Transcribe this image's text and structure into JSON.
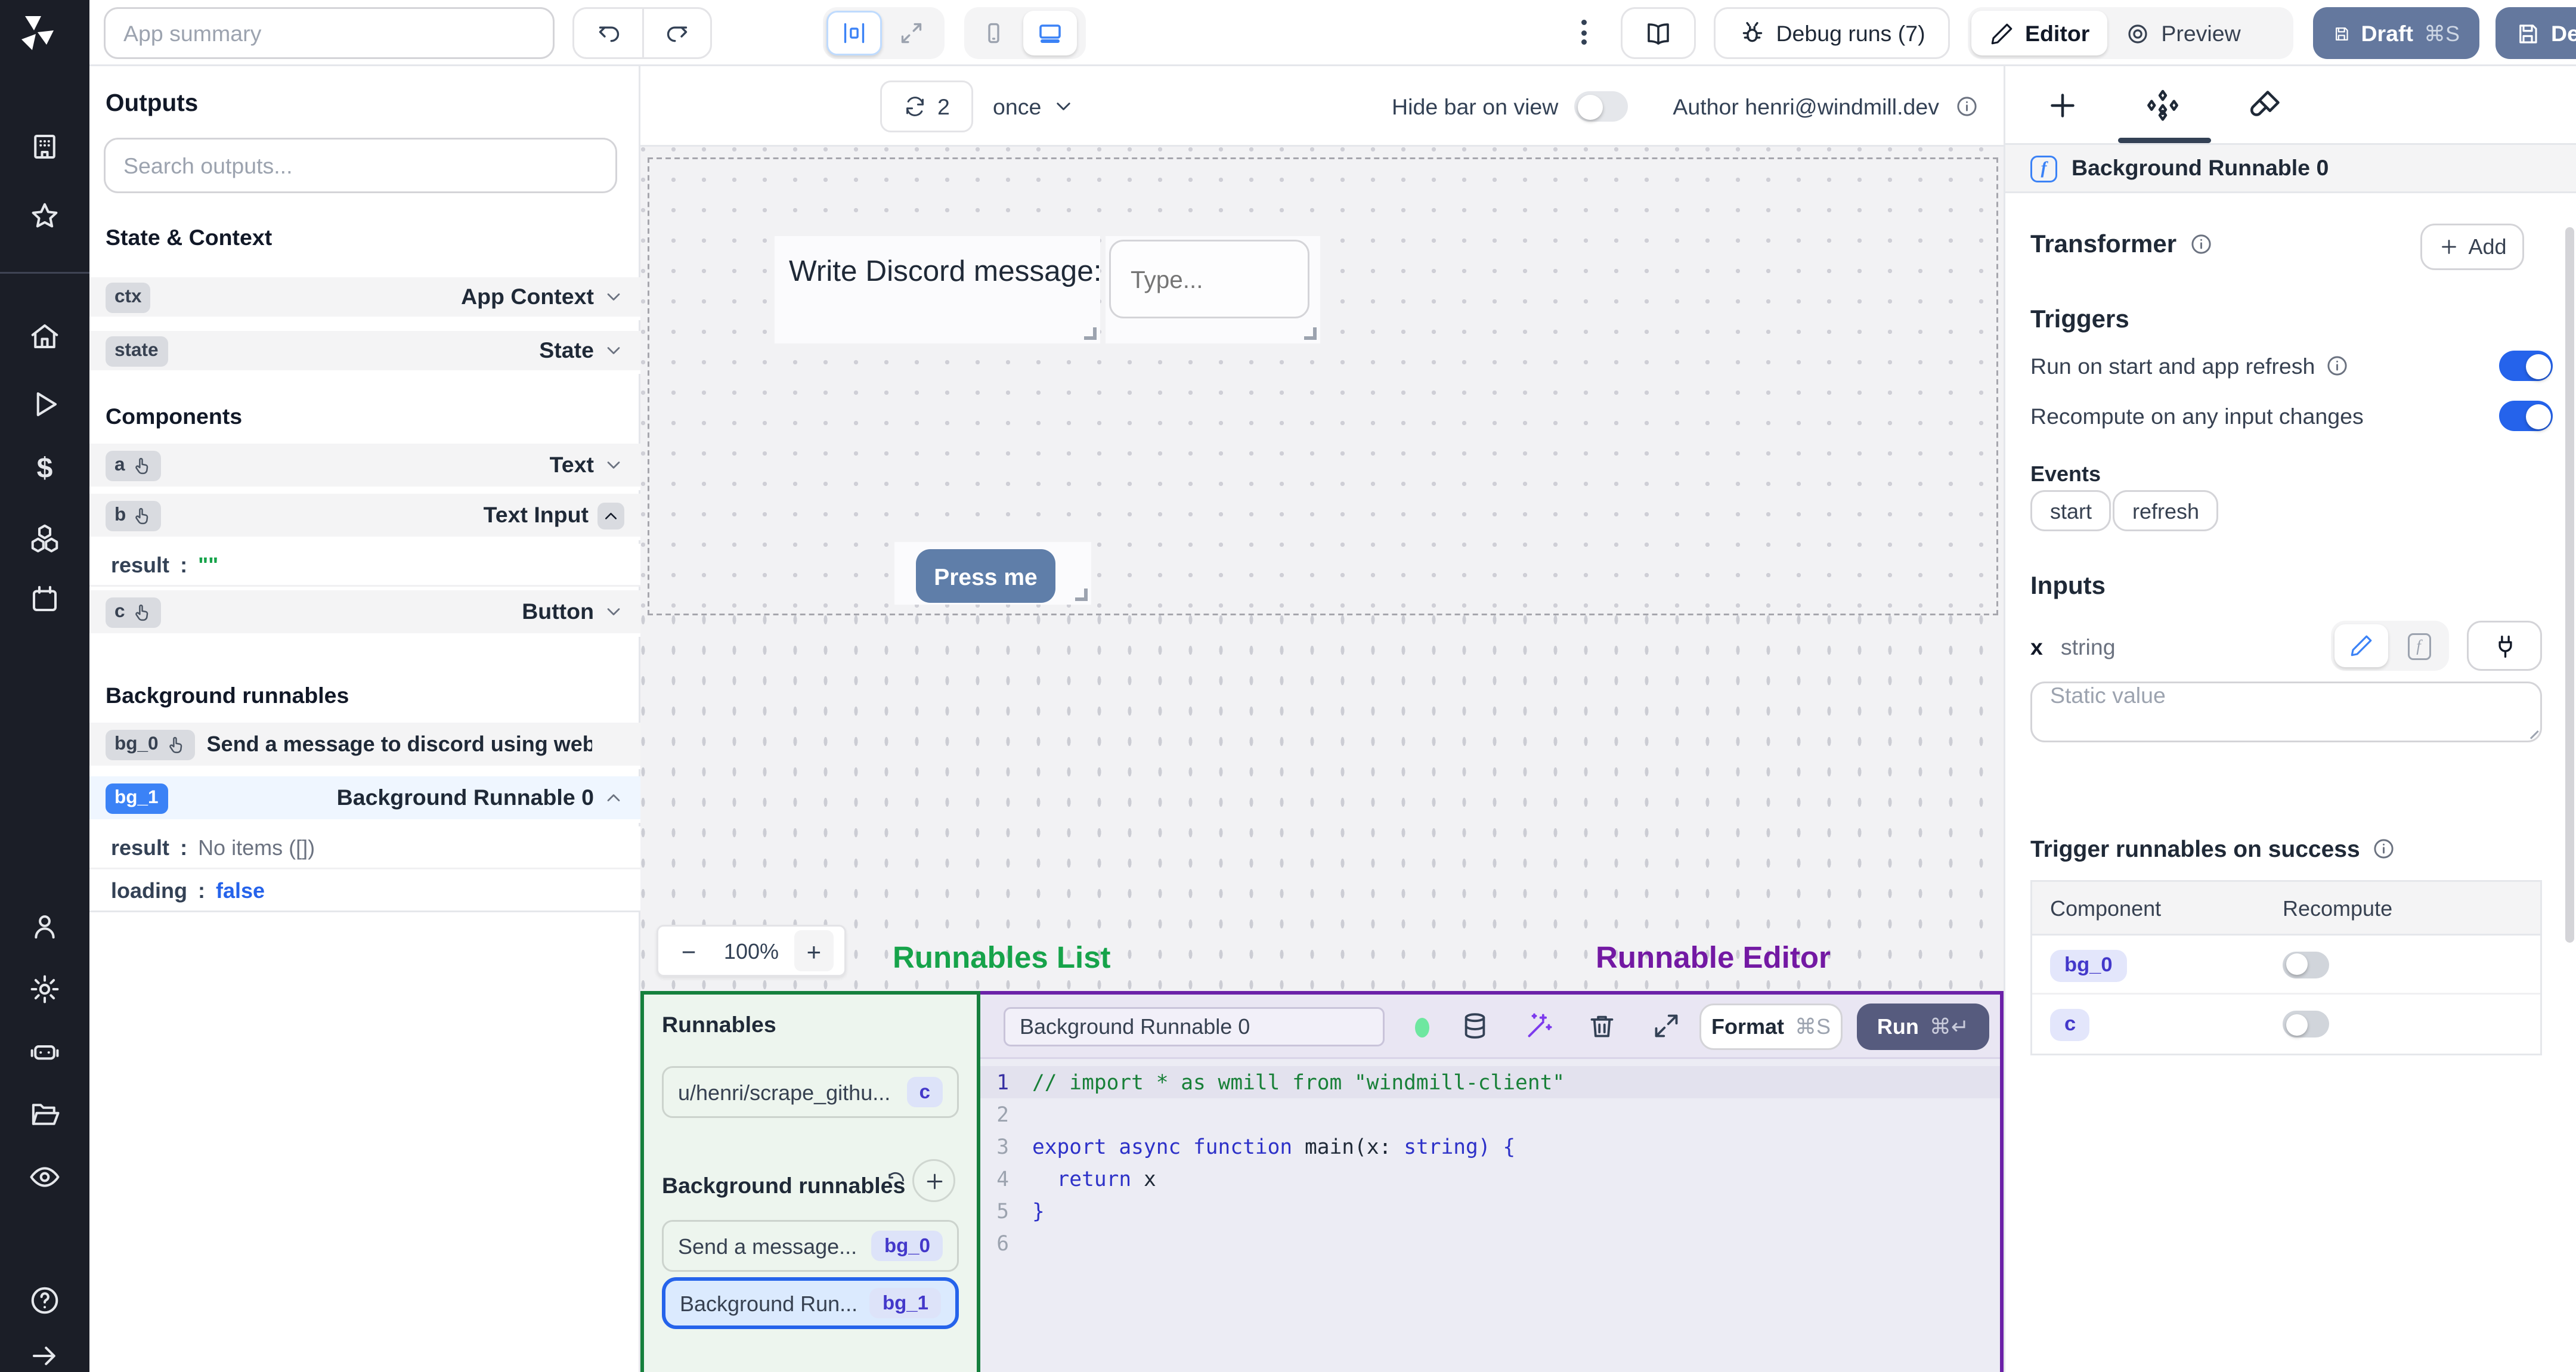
{
  "topbar": {
    "app_summary_placeholder": "App summary",
    "debug_runs": "Debug runs (7)",
    "editor": "Editor",
    "preview": "Preview",
    "draft": "Draft",
    "draft_shortcut": "⌘S",
    "deploy": "Deploy"
  },
  "canvas_bar": {
    "refresh_count": "2",
    "mode": "once",
    "hide_bar_label": "Hide bar on view",
    "author": "Author henri@windmill.dev"
  },
  "canvas": {
    "text_component": "Write Discord message:",
    "input_placeholder": "Type...",
    "button_label": "Press me",
    "zoom_out": "−",
    "zoom_level": "100%",
    "zoom_in": "+"
  },
  "annotations": {
    "runnables_list": "Runnables List",
    "runnable_editor": "Runnable Editor"
  },
  "outputs": {
    "title": "Outputs",
    "search_placeholder": "Search outputs...",
    "state_context_title": "State & Context",
    "ctx_badge": "ctx",
    "ctx_type": "App Context",
    "state_badge": "state",
    "state_type": "State",
    "components_title": "Components",
    "a_badge": "a",
    "a_type": "Text",
    "b_badge": "b",
    "b_type": "Text Input",
    "b_result_key": "result",
    "b_result_colon": ":",
    "b_result_value": "\"\"",
    "c_badge": "c",
    "c_type": "Button",
    "bg_title": "Background runnables",
    "bg0_badge": "bg_0",
    "bg0_title": "Send a message to discord using webhoo",
    "bg1_badge": "bg_1",
    "bg1_title": "Background Runnable 0",
    "bg1_result_key": "result",
    "bg1_result_colon": ":",
    "bg1_result_value": "No items ([])",
    "bg1_loading_key": "loading",
    "bg1_loading_colon": ":",
    "bg1_loading_value": "false"
  },
  "runnables_panel": {
    "title": "Runnables",
    "item1_label": "u/henri/scrape_githu...",
    "item1_badge": "c",
    "bg_title": "Background runnables",
    "item2_label": "Send a message...",
    "item2_badge": "bg_0",
    "item3_label": "Background Run...",
    "item3_badge": "bg_1"
  },
  "editor_panel": {
    "name_value": "Background Runnable 0",
    "format": "Format",
    "format_shortcut": "⌘S",
    "run": "Run",
    "run_shortcut": "⌘↵"
  },
  "code": {
    "lines": [
      {
        "n": "1",
        "tokens": [
          {
            "t": "// import * as wmill from \"windmill-client\"",
            "c": "comment"
          }
        ]
      },
      {
        "n": "2",
        "tokens": []
      },
      {
        "n": "3",
        "tokens": [
          {
            "t": "export async function",
            "c": "kw"
          },
          {
            "t": " main",
            "c": "plain"
          },
          {
            "t": "(x: ",
            "c": "plain"
          },
          {
            "t": "string",
            "c": "kw"
          },
          {
            "t": ") {",
            "c": "kw"
          }
        ]
      },
      {
        "n": "4",
        "tokens": [
          {
            "t": "  return",
            "c": "kw"
          },
          {
            "t": " x",
            "c": "plain"
          }
        ]
      },
      {
        "n": "5",
        "tokens": [
          {
            "t": "}",
            "c": "kw"
          }
        ]
      },
      {
        "n": "6",
        "tokens": []
      }
    ]
  },
  "inspector": {
    "selected_title": "Background Runnable 0",
    "transformer_title": "Transformer",
    "add_label": "Add",
    "triggers_title": "Triggers",
    "run_on_start": "Run on start and app refresh",
    "recompute_on_change": "Recompute on any input changes",
    "events_title": "Events",
    "event_start": "start",
    "event_refresh": "refresh",
    "inputs_title": "Inputs",
    "input_name": "x",
    "input_type": "string",
    "static_placeholder": "Static value",
    "trigger_success_title": "Trigger runnables on success",
    "col_component": "Component",
    "col_recompute": "Recompute",
    "row1_component": "bg_0",
    "row2_component": "c"
  },
  "colors": {
    "accent_blue": "#2563eb",
    "annotation_green": "#16a34a",
    "annotation_purple": "#7319a3",
    "draft_deploy_bg": "#64789e",
    "press_me_bg": "#5f7ea9",
    "run_button_bg": "#565b7e",
    "selected_badge_blue": "#3b82f6"
  }
}
